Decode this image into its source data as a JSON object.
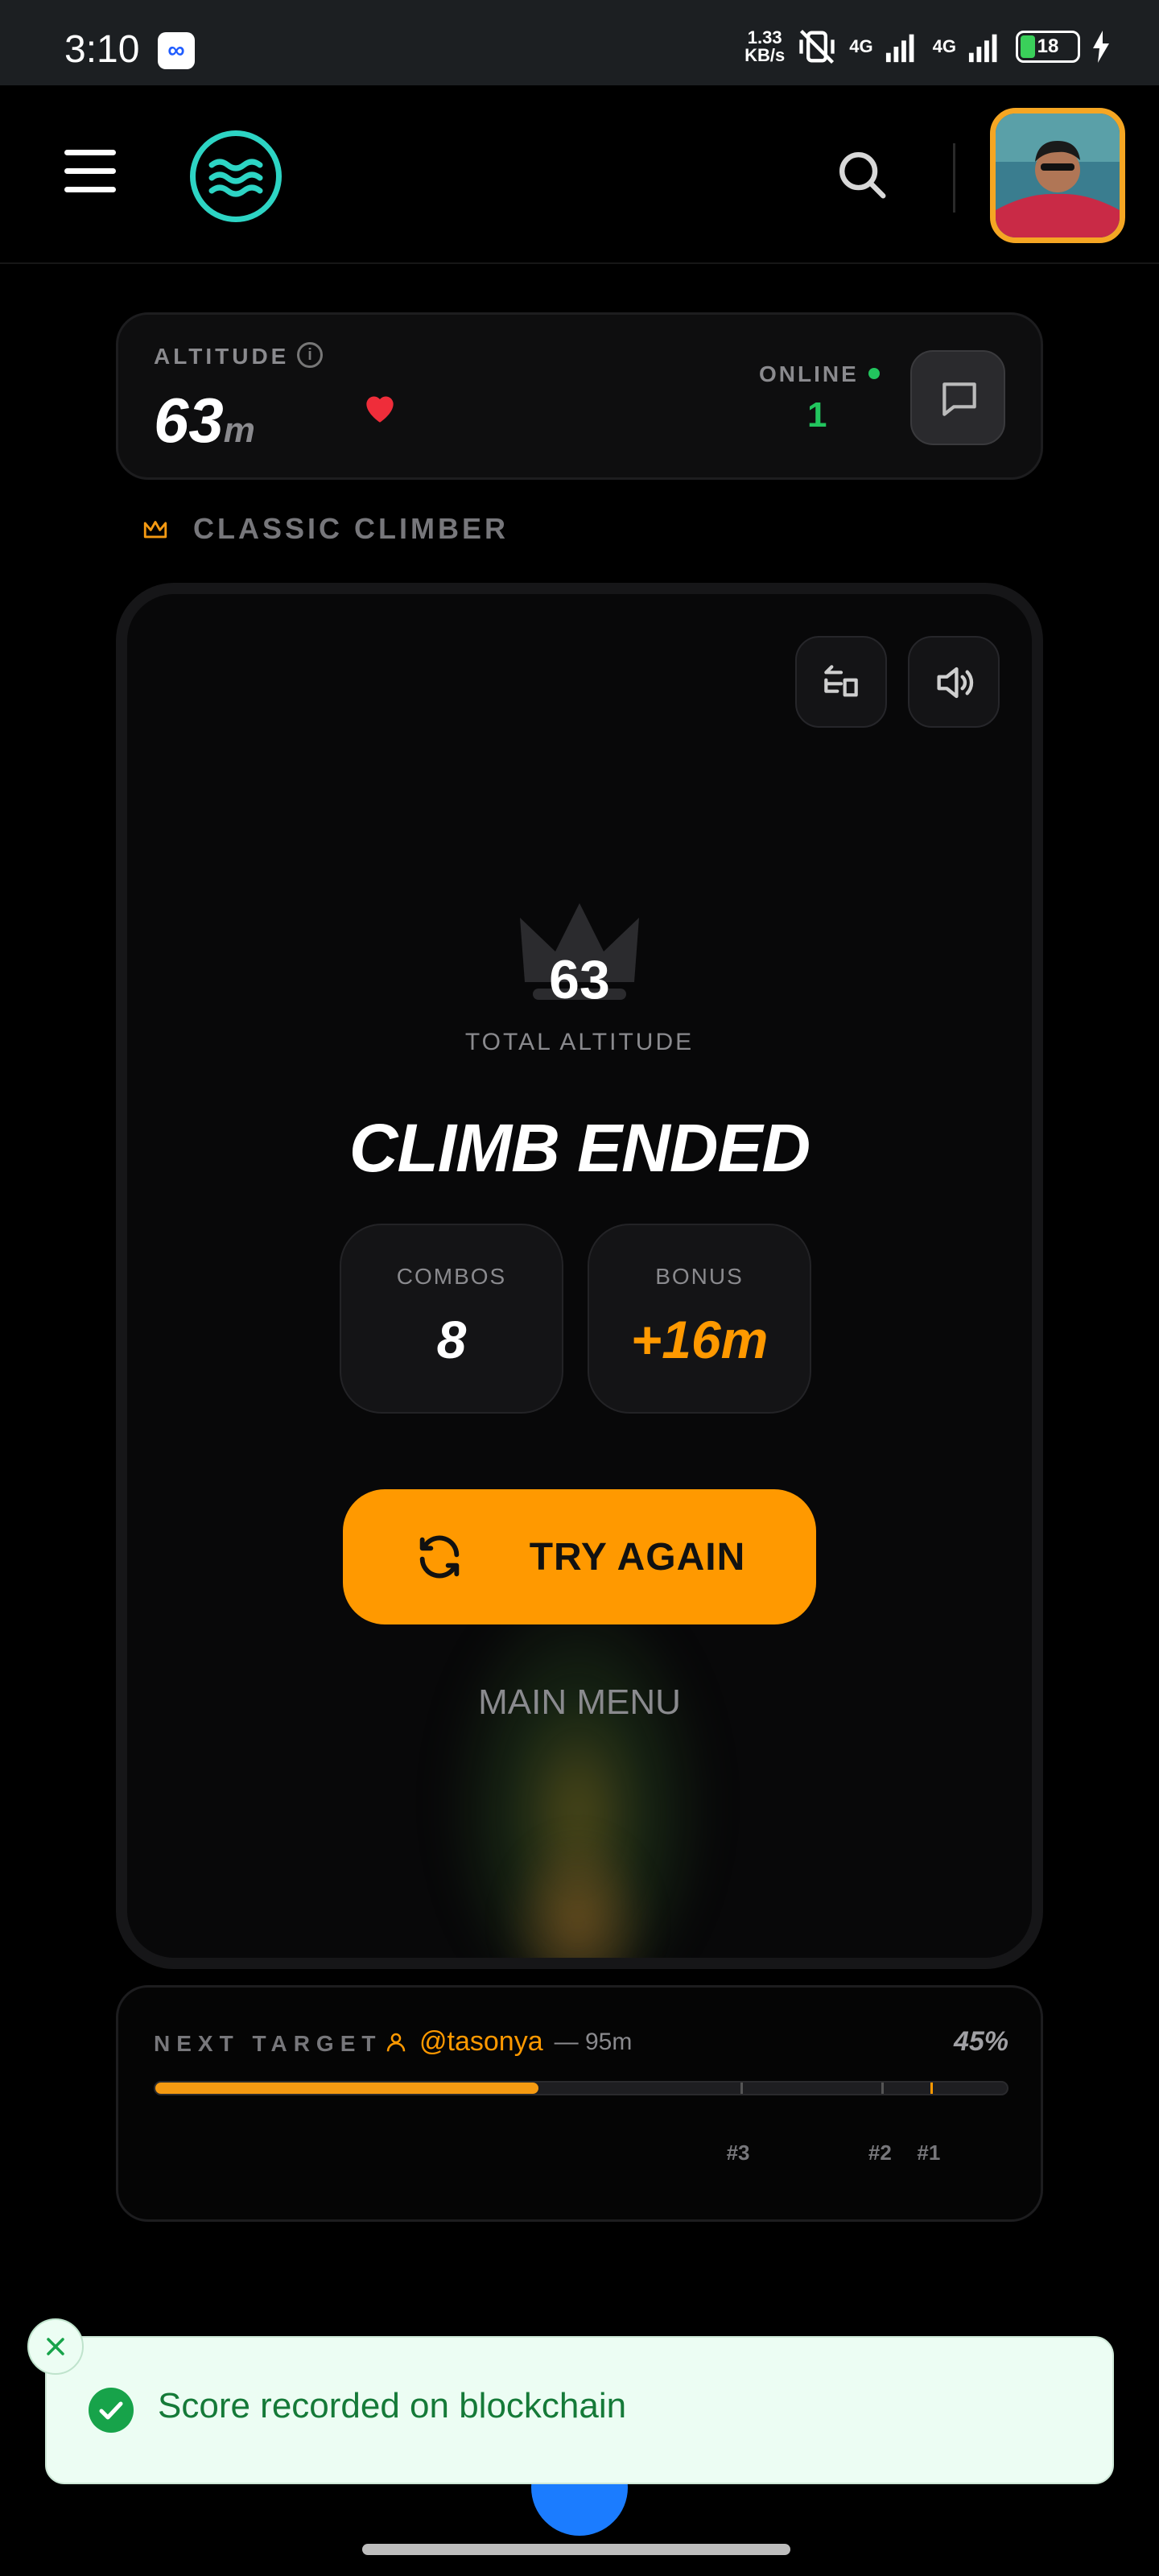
{
  "status_bar": {
    "time": "3:10",
    "app_icon": "meta-icon",
    "net_speed_value": "1.33",
    "net_speed_unit": "KB/s",
    "net1": "4G",
    "net2": "4G",
    "battery": "18"
  },
  "header": {
    "menu_icon": "hamburger-icon",
    "logo": "waves-logo-icon",
    "search_icon": "search-icon",
    "avatar": "profile-avatar"
  },
  "altitude_card": {
    "label": "ALTITUDE",
    "info_icon": "i",
    "value": "63",
    "unit": "m",
    "online_label": "ONLINE",
    "online_count": "1"
  },
  "mode": {
    "label": "CLASSIC CLIMBER",
    "icon": "crown-outline-icon"
  },
  "game": {
    "total_value": "63",
    "total_label": "TOTAL ALTITUDE",
    "title": "CLIMB ENDED",
    "combos_label": "COMBOS",
    "combos_value": "8",
    "bonus_label": "BONUS",
    "bonus_value": "+16m",
    "try_again": "TRY AGAIN",
    "main_menu": "MAIN MENU"
  },
  "next_target": {
    "label": "NEXT TARGET",
    "user": "@tasonya",
    "distance": "— 95m",
    "percent": "45%",
    "progress": 0.45,
    "ranks": [
      {
        "label": "#3",
        "pos": 0.687
      },
      {
        "label": "#2",
        "pos": 0.853
      },
      {
        "label": "#1",
        "pos": 0.91
      }
    ]
  },
  "toast": {
    "message": "Score recorded on blockchain"
  },
  "colors": {
    "accent": "#ff9900",
    "success": "#22c55e",
    "logo": "#2dd4c4"
  }
}
